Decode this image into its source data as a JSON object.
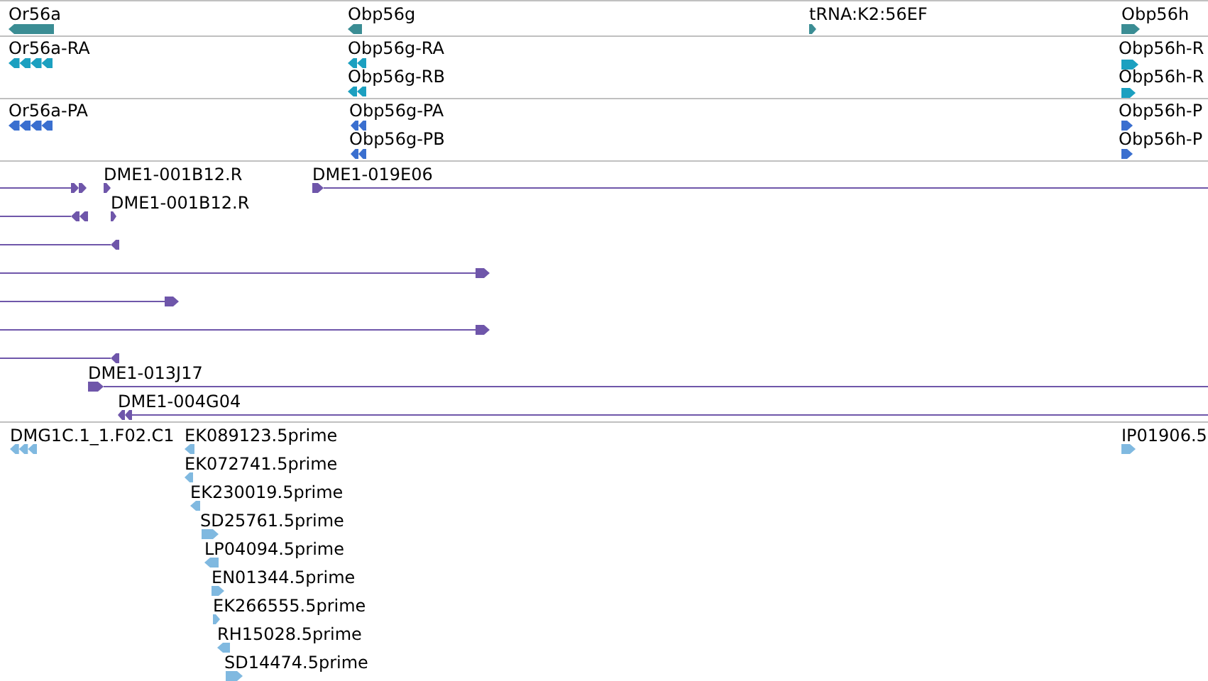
{
  "tracks": [
    {
      "color": "#3b8d94",
      "features": [
        {
          "label": "Or56a",
          "reverse": true
        },
        {
          "label": "Obp56g",
          "reverse": true
        },
        {
          "label": "tRNA:K2:56EF",
          "reverse": false
        },
        {
          "label": "Obp56h",
          "reverse": false
        }
      ]
    },
    {
      "color": "#1ca0c0",
      "features": [
        {
          "label": "Or56a-RA",
          "reverse": true
        },
        {
          "label": "Obp56g-RA",
          "reverse": true
        },
        {
          "label": "Obp56g-RB",
          "reverse": true
        },
        {
          "label": "Obp56h-R",
          "reverse": false
        },
        {
          "label": "Obp56h-R",
          "reverse": false
        }
      ]
    },
    {
      "color": "#3a6fcf",
      "features": [
        {
          "label": "Or56a-PA",
          "reverse": true
        },
        {
          "label": "Obp56g-PA",
          "reverse": true
        },
        {
          "label": "Obp56g-PB",
          "reverse": true
        },
        {
          "label": "Obp56h-P",
          "reverse": false
        },
        {
          "label": "Obp56h-P",
          "reverse": false
        }
      ]
    },
    {
      "color": "#6f56aa",
      "features": [
        {
          "reverse": false
        },
        {
          "label": "DME1-001B12.R",
          "reverse": false
        },
        {
          "label": "DME1-019E06",
          "reverse": false
        },
        {
          "reverse": true
        },
        {
          "label": "DME1-001B12.R",
          "reverse": false
        },
        {
          "reverse": true
        },
        {
          "reverse": false
        },
        {
          "reverse": false
        },
        {
          "reverse": false
        },
        {
          "reverse": true
        },
        {
          "label": "DME1-013J17",
          "reverse": false
        },
        {
          "label": "DME1-004G04",
          "reverse": true
        }
      ]
    },
    {
      "color": "#80b9e0",
      "features": [
        {
          "label": "DMG1C.1_1.F02.C1",
          "reverse": true
        },
        {
          "label": "EK089123.5prime",
          "reverse": true
        },
        {
          "label": "EK072741.5prime",
          "reverse": true
        },
        {
          "label": "EK230019.5prime",
          "reverse": true
        },
        {
          "label": "SD25761.5prime",
          "reverse": false
        },
        {
          "label": "LP04094.5prime",
          "reverse": true
        },
        {
          "label": "EN01344.5prime",
          "reverse": false
        },
        {
          "label": "EK266555.5prime",
          "reverse": false
        },
        {
          "label": "RH15028.5prime",
          "reverse": true
        },
        {
          "label": "SD14474.5prime",
          "reverse": false
        },
        {
          "label": "IP01906.5",
          "reverse": false
        }
      ]
    }
  ]
}
